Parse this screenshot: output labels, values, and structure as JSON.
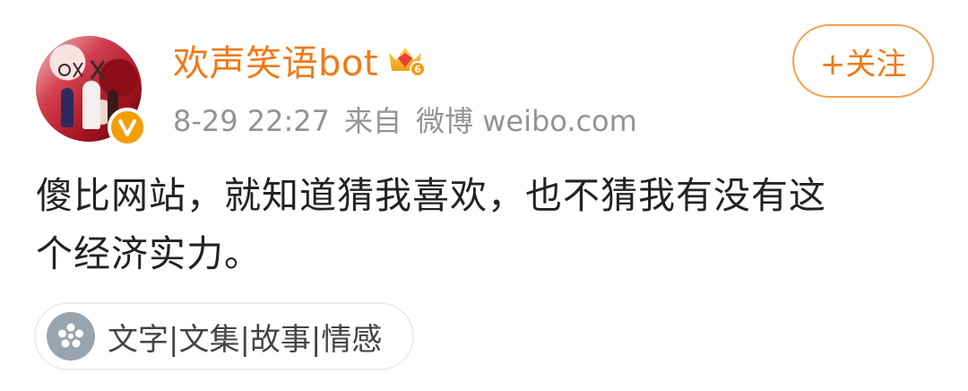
{
  "user": {
    "name": "欢声笑语bot",
    "avatar_icon": "user-avatar-image",
    "verified_icon": "verified-v-icon",
    "verified_color": "#f29d00",
    "vip_icon": "vip-crown-icon",
    "vip_level": "6",
    "name_color": "#f07a17"
  },
  "meta": {
    "time": "8-29 22:27",
    "source_prefix": "来自",
    "source": "微博 weibo.com"
  },
  "follow_button": {
    "label": "+关注",
    "color": "#f07a17"
  },
  "post": {
    "text_line1": "傻比网站，就知道猜我喜欢，也不猜我有没有这",
    "text_line2": "个经济实力。"
  },
  "topic": {
    "icon": "topic-flower-icon",
    "label": "文字|文集|故事|情感"
  }
}
